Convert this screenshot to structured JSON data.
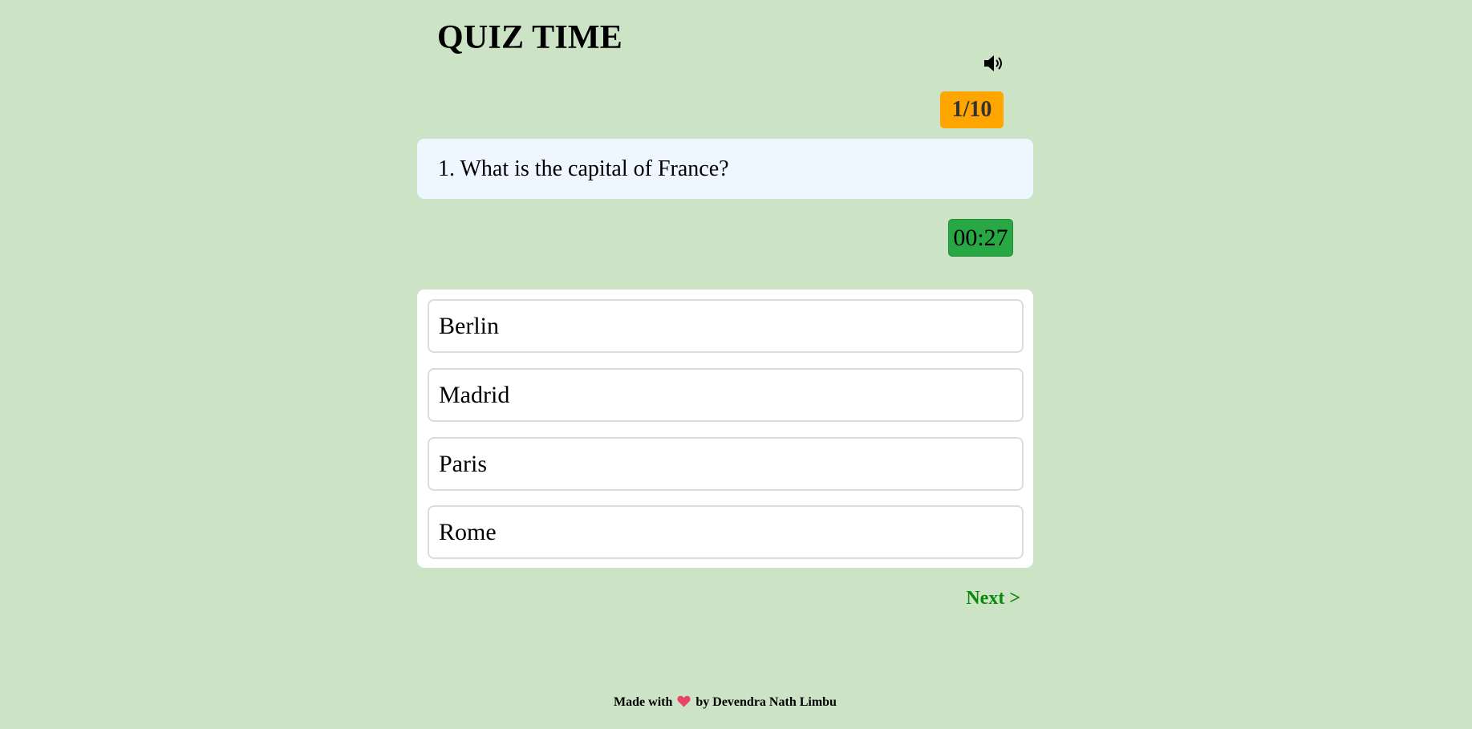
{
  "header": {
    "title": "QUIZ TIME"
  },
  "icons": {
    "sound": "speaker-volume-icon",
    "heart": "heart-icon"
  },
  "progress": {
    "label": "1/10",
    "current": 1,
    "total": 10
  },
  "question": {
    "text": "1. What is the capital of France?"
  },
  "timer": {
    "value": "00:27"
  },
  "options": [
    {
      "label": "Berlin"
    },
    {
      "label": "Madrid"
    },
    {
      "label": "Paris"
    },
    {
      "label": "Rome"
    }
  ],
  "navigation": {
    "next_label": "Next >"
  },
  "footer": {
    "prefix": "Made with",
    "suffix": "by Devendra Nath Limbu"
  },
  "colors": {
    "background": "#cde3c5",
    "counter_badge": "#ffa500",
    "timer_badge": "#28a745",
    "question_box": "#eef6ff",
    "next_link": "#0a8a0a",
    "heart": "#e8436a"
  }
}
